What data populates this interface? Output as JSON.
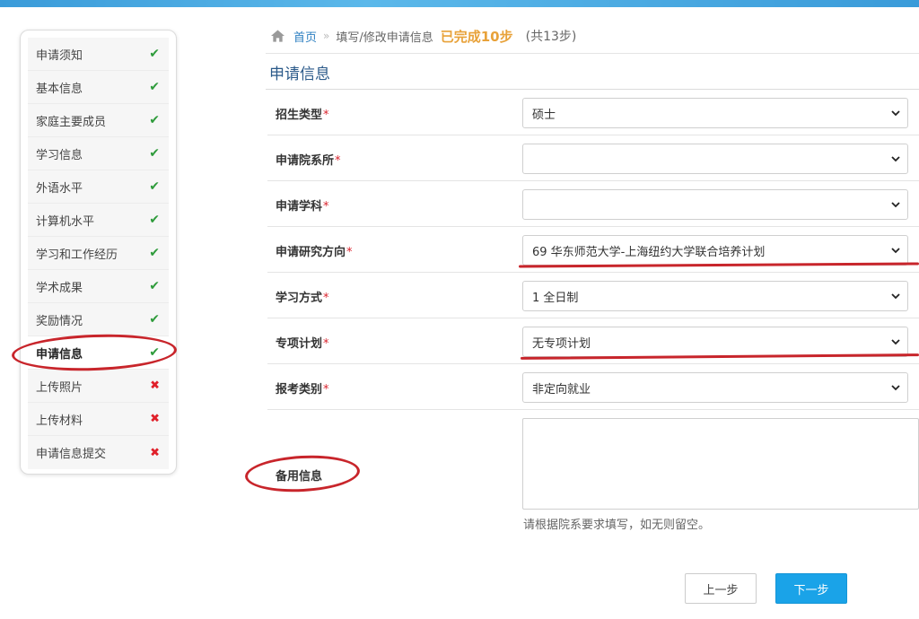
{
  "breadcrumb": {
    "home": "首页",
    "separator": "»",
    "current": "填写/修改申请信息",
    "progress": "已完成10步",
    "total": "(共13步)"
  },
  "section_title": "申请信息",
  "sidebar": {
    "items": [
      {
        "label": "申请须知",
        "status": "✔"
      },
      {
        "label": "基本信息",
        "status": "✔"
      },
      {
        "label": "家庭主要成员",
        "status": "✔"
      },
      {
        "label": "学习信息",
        "status": "✔"
      },
      {
        "label": "外语水平",
        "status": "✔"
      },
      {
        "label": "计算机水平",
        "status": "✔"
      },
      {
        "label": "学习和工作经历",
        "status": "✔"
      },
      {
        "label": "学术成果",
        "status": "✔"
      },
      {
        "label": "奖励情况",
        "status": "✔"
      },
      {
        "label": "申请信息",
        "status": "✔"
      },
      {
        "label": "上传照片",
        "status": "✖"
      },
      {
        "label": "上传材料",
        "status": "✖"
      },
      {
        "label": "申请信息提交",
        "status": "✖"
      }
    ]
  },
  "form": {
    "required_mark": "*",
    "rows": [
      {
        "label": "招生类型",
        "value": ""
      },
      {
        "label": "申请院系所",
        "value": ""
      },
      {
        "label": "申请学科",
        "value": ""
      },
      {
        "label": "申请研究方向",
        "value": "69 华东师范大学-上海纽约大学联合培养计划"
      },
      {
        "label": "学习方式",
        "value": "1 全日制"
      },
      {
        "label": "专项计划",
        "value": "无专项计划"
      },
      {
        "label": "报考类别",
        "value": "非定向就业"
      }
    ],
    "first_value": "硕士",
    "trailing_text": "",
    "backup_label": "备用信息",
    "backup_value": "",
    "help_text": "请根据院系要求填写，如无则留空。"
  },
  "buttons": {
    "prev": "上一步",
    "next": "下一步"
  },
  "colors": {
    "accent": "#1aa3e8",
    "done": "#2e9b3b",
    "todo": "#e0202a",
    "progress": "#e8a23a",
    "annotation": "#c8252b"
  }
}
